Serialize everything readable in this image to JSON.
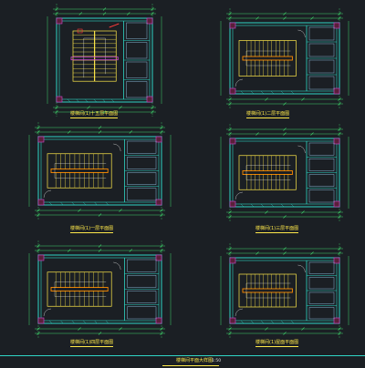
{
  "drawing": {
    "footer": {
      "title": "楼梯间平面大样图",
      "scale": "1:50"
    },
    "plans": [
      {
        "id": "p1",
        "caption": "楼梯间(1)十五层平面图"
      },
      {
        "id": "p2",
        "caption": "楼梯间(1)二层平面图"
      },
      {
        "id": "p3",
        "caption": "楼梯间(1)一层平面图"
      },
      {
        "id": "p4",
        "caption": "楼梯间(1)三层平面图"
      },
      {
        "id": "p5",
        "caption": "楼梯间(1)四层平面图"
      },
      {
        "id": "p6",
        "caption": "楼梯间(1)屋面平面图"
      }
    ]
  },
  "colors": {
    "background": "#1b1f24",
    "wall": "#2fd6c6",
    "stair": "#ffe94a",
    "dimension": "#3fd46b",
    "accent_red": "#ff3b3b",
    "accent_magenta": "#d04bd0",
    "text": "#ffe94a"
  }
}
